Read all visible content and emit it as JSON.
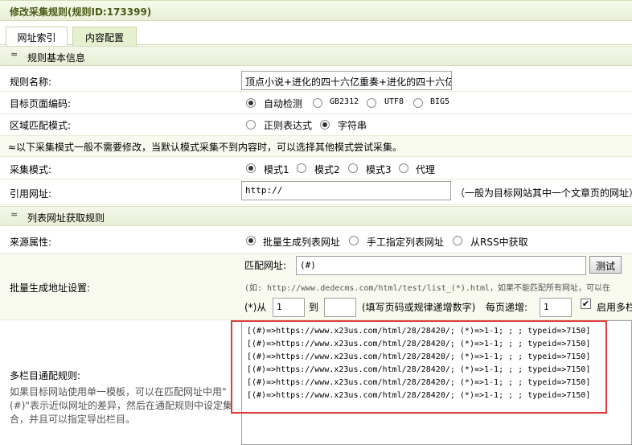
{
  "page_title": "修改采集规则(规则ID:173399)",
  "tabs": [
    {
      "label": "网址索引",
      "active": false
    },
    {
      "label": "内容配置",
      "active": true
    }
  ],
  "section_basic": {
    "toggle_glyph": "≈",
    "title": "规则基本信息"
  },
  "rule_name": {
    "label": "规则名称:",
    "value": "顶点小说+进化的四十六亿重奏+进化的四十六亿"
  },
  "encoding": {
    "label": "目标页面编码:",
    "options": [
      "自动检测",
      "GB2312",
      "UTF8",
      "BIG5"
    ],
    "selected": "自动检测"
  },
  "match_mode": {
    "label": "区域匹配模式:",
    "options": [
      "正则表达式",
      "字符串"
    ],
    "selected": "字符串"
  },
  "notice": "≈以下采集模式一般不需要修改，当默认模式采集不到内容时，可以选择其他模式尝试采集。",
  "collect_mode": {
    "label": "采集模式:",
    "options": [
      "模式1",
      "模式2",
      "模式3",
      "代理"
    ],
    "selected": "模式1"
  },
  "referer": {
    "label": "引用网址:",
    "value": "http://",
    "hint": "（一般为目标网站其中一个文章页的网址）"
  },
  "section_list": {
    "toggle_glyph": "≈",
    "title": "列表网址获取规则"
  },
  "source": {
    "label": "来源属性:",
    "options": [
      "批量生成列表网址",
      "手工指定列表网址",
      "从RSS中获取"
    ],
    "selected": "批量生成列表网址"
  },
  "batch": {
    "label": "批量生成地址设置:",
    "match_label": "匹配网址:",
    "match_value": "(#)",
    "test_button": "测试",
    "example": "(如: http://www.dedecms.com/html/test/list_(*).html，如果不能匹配所有网址，可以在",
    "from_label": "(*)从",
    "from_value": "1",
    "to_label": "到",
    "to_value": "",
    "to_hint": "(填写页码或规律递增数字)",
    "step_label": "每页递增:",
    "step_value": "1",
    "enable_label": "启用多栏",
    "enable_checked": true
  },
  "multi": {
    "label": "多栏目通配规则:",
    "desc_lines": [
      "如果目标网站使用单一模板，可以在匹配网址中用\"",
      "(#)\"表示近似网址的差异，然后在通配规则中设定集",
      "合，并且可以指定导出栏目。"
    ],
    "rules": [
      "[(#)=>https://www.x23us.com/html/28/28420/; (*)=>1-1; ; ; typeid=>7150]",
      "[(#)=>https://www.x23us.com/html/28/28420/; (*)=>1-1; ; ; typeid=>7150]",
      "[(#)=>https://www.x23us.com/html/28/28420/; (*)=>1-1; ; ; typeid=>7150]",
      "[(#)=>https://www.x23us.com/html/28/28420/; (*)=>1-1; ; ; typeid=>7150]",
      "[(#)=>https://www.x23us.com/html/28/28420/; (*)=>1-1; ; ; typeid=>7150]",
      "[(#)=>https://www.x23us.com/html/28/28420/; (*)=>1-1; ; ; typeid=>7150]"
    ]
  },
  "colors": {
    "highlight_border": "#e03c3c",
    "tab_active_bg": "#e5f0cf",
    "title_text": "#4b5a14"
  }
}
